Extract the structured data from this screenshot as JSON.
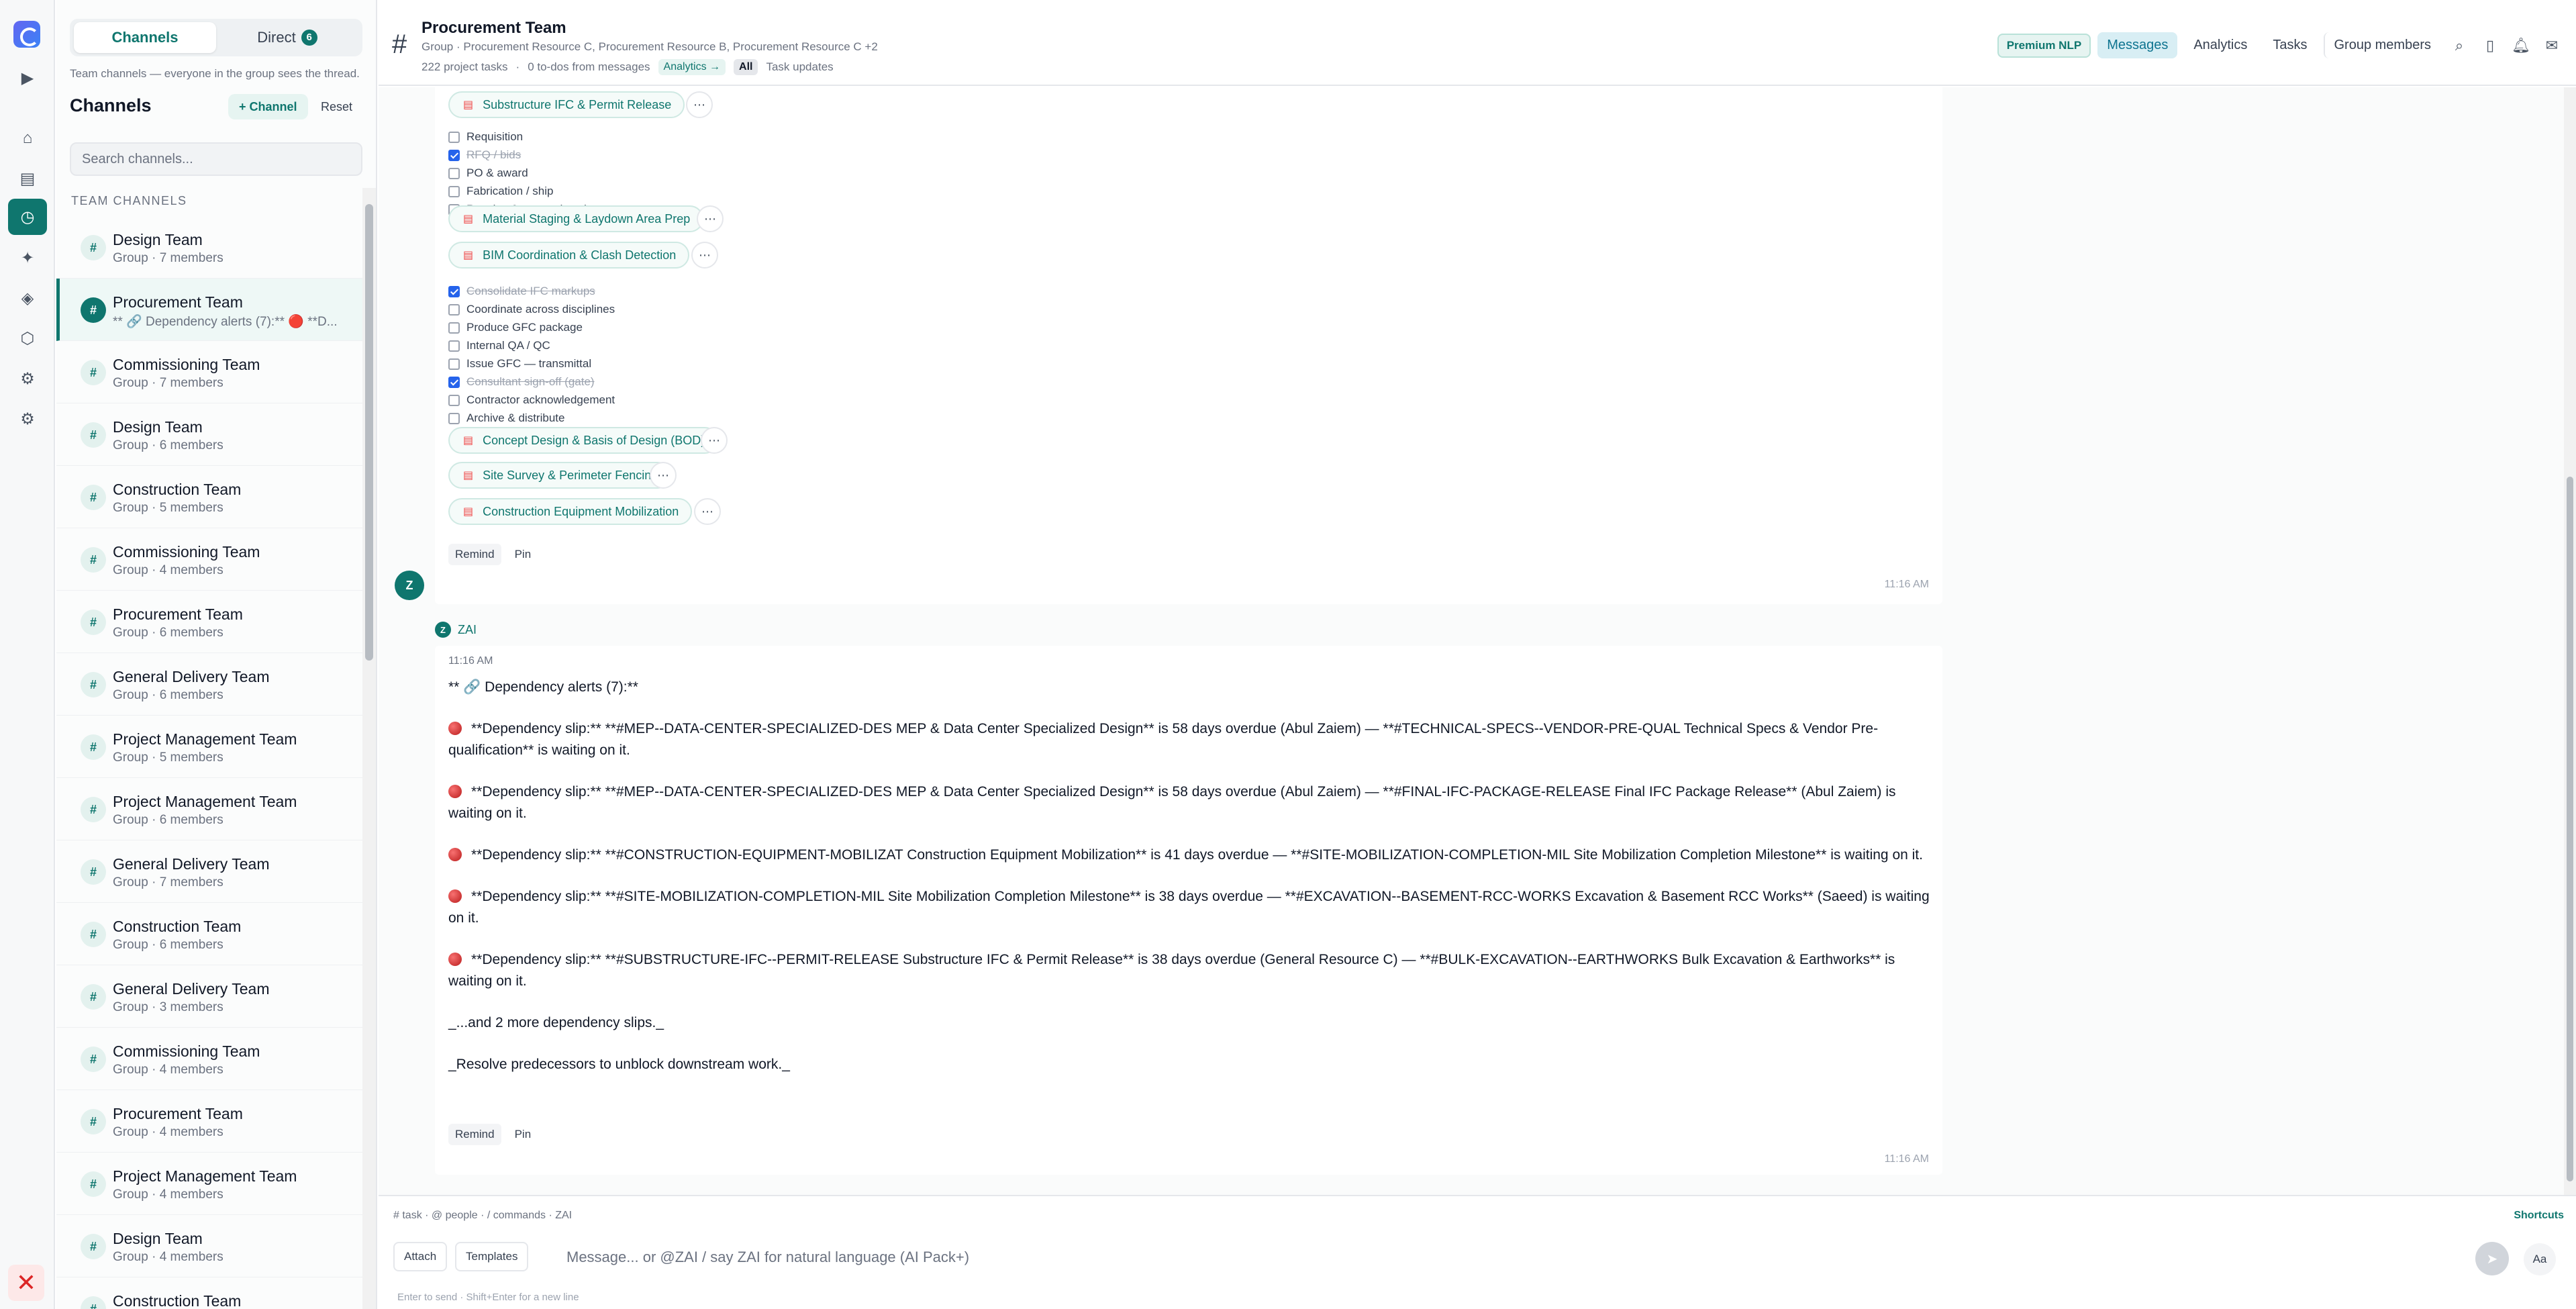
{
  "rail": {
    "icons": [
      "app-logo",
      "play-icon",
      "home-icon",
      "layout-icon",
      "clock-icon",
      "sparkle-icon",
      "diamond-icon",
      "hexagon-icon",
      "settings-icon",
      "settings-alt-icon",
      "close-icon"
    ]
  },
  "sidebar": {
    "tab_channels": "Channels",
    "tab_direct": "Direct",
    "direct_count": "6",
    "hint": "Team channels — everyone in the group sees the thread.",
    "title": "Channels",
    "add_channel": "+ Channel",
    "reset": "Reset",
    "search_placeholder": "Search channels...",
    "section_label": "TEAM CHANNELS",
    "channels": [
      {
        "name": "Design Team",
        "sub": "Group · 7 members"
      },
      {
        "name": "Procurement Team",
        "sub": "** 🔗 Dependency alerts (7):** 🔴 **D..."
      },
      {
        "name": "Commissioning Team",
        "sub": "Group · 7 members"
      },
      {
        "name": "Design Team",
        "sub": "Group · 6 members"
      },
      {
        "name": "Construction Team",
        "sub": "Group · 5 members"
      },
      {
        "name": "Commissioning Team",
        "sub": "Group · 4 members"
      },
      {
        "name": "Procurement Team",
        "sub": "Group · 6 members"
      },
      {
        "name": "General Delivery Team",
        "sub": "Group · 6 members"
      },
      {
        "name": "Project Management Team",
        "sub": "Group · 5 members"
      },
      {
        "name": "Project Management Team",
        "sub": "Group · 6 members"
      },
      {
        "name": "General Delivery Team",
        "sub": "Group · 7 members"
      },
      {
        "name": "Construction Team",
        "sub": "Group · 6 members"
      },
      {
        "name": "General Delivery Team",
        "sub": "Group · 3 members"
      },
      {
        "name": "Commissioning Team",
        "sub": "Group · 4 members"
      },
      {
        "name": "Procurement Team",
        "sub": "Group · 4 members"
      },
      {
        "name": "Project Management Team",
        "sub": "Group · 4 members"
      },
      {
        "name": "Design Team",
        "sub": "Group · 4 members"
      },
      {
        "name": "Construction Team",
        "sub": ""
      }
    ]
  },
  "header": {
    "title": "Procurement Team",
    "subtitle": "Group · Procurement Resource C, Procurement Resource B, Procurement Resource C +2",
    "tasks": "222 project tasks",
    "todos": "0 to-dos from messages",
    "analytics_link": "Analytics →",
    "filter_all": "All",
    "filter_updates": "Task updates",
    "premium": "Premium NLP",
    "tabs": [
      "Messages",
      "Analytics",
      "Tasks",
      "Group members"
    ]
  },
  "message1": {
    "chips": [
      "Substructure IFC & Permit Release",
      "Material Staging & Laydown Area Prep",
      "BIM Coordination & Clash Detection",
      "Concept Design & Basis of Design (BOD)",
      "Site Survey & Perimeter Fencing",
      "Construction Equipment Mobilization"
    ],
    "checklist_a": [
      {
        "label": "Requisition",
        "done": false
      },
      {
        "label": "RFQ / bids",
        "done": true
      },
      {
        "label": "PO & award",
        "done": false
      },
      {
        "label": "Fabrication / ship",
        "done": false
      },
      {
        "label": "Receive & accept (gate)",
        "done": false
      }
    ],
    "checklist_b": [
      {
        "label": "Consolidate IFC markups",
        "done": true
      },
      {
        "label": "Coordinate across disciplines",
        "done": false
      },
      {
        "label": "Produce GFC package",
        "done": false
      },
      {
        "label": "Internal QA / QC",
        "done": false
      },
      {
        "label": "Issue GFC — transmittal",
        "done": false
      },
      {
        "label": "Consultant sign-off (gate)",
        "done": true
      },
      {
        "label": "Contractor acknowledgement",
        "done": false
      },
      {
        "label": "Archive & distribute",
        "done": false
      }
    ],
    "remind": "Remind",
    "pin": "Pin",
    "time": "11:16 AM",
    "avatar": "Z"
  },
  "message2": {
    "sender": "ZAI",
    "sender_initial": "Z",
    "time": "11:16 AM",
    "heading": "** 🔗 Dependency alerts (7):**",
    "alerts": [
      "**Dependency slip:** **#MEP--DATA-CENTER-SPECIALIZED-DES MEP & Data Center Specialized Design** is 58 days overdue (Abul Zaiem) — **#TECHNICAL-SPECS--VENDOR-PRE-QUAL Technical Specs & Vendor Pre-qualification** is waiting on it.",
      "**Dependency slip:** **#MEP--DATA-CENTER-SPECIALIZED-DES MEP & Data Center Specialized Design** is 58 days overdue (Abul Zaiem) — **#FINAL-IFC-PACKAGE-RELEASE Final IFC Package Release** (Abul Zaiem) is waiting on it.",
      "**Dependency slip:** **#CONSTRUCTION-EQUIPMENT-MOBILIZAT Construction Equipment Mobilization** is 41 days overdue — **#SITE-MOBILIZATION-COMPLETION-MIL Site Mobilization Completion Milestone** is waiting on it.",
      "**Dependency slip:** **#SITE-MOBILIZATION-COMPLETION-MIL Site Mobilization Completion Milestone** is 38 days overdue — **#EXCAVATION--BASEMENT-RCC-WORKS Excavation & Basement RCC Works** (Saeed) is waiting on it.",
      "**Dependency slip:** **#SUBSTRUCTURE-IFC--PERMIT-RELEASE Substructure IFC & Permit Release** is 38 days overdue (General Resource C) — **#BULK-EXCAVATION--EARTHWORKS Bulk Excavation & Earthworks** is waiting on it."
    ],
    "more": "_...and 2 more dependency slips._",
    "resolve": "_Resolve predecessors to unblock downstream work._",
    "remind": "Remind",
    "pin": "Pin"
  },
  "composer": {
    "hints": "# task · @ people · / commands · ZAI",
    "shortcuts": "Shortcuts",
    "attach": "Attach",
    "templates": "Templates",
    "placeholder": "Message... or @ZAI / say ZAI for natural language (AI Pack+)",
    "aa": "Aa",
    "enter_hint": "Enter to send · Shift+Enter for a new line"
  }
}
